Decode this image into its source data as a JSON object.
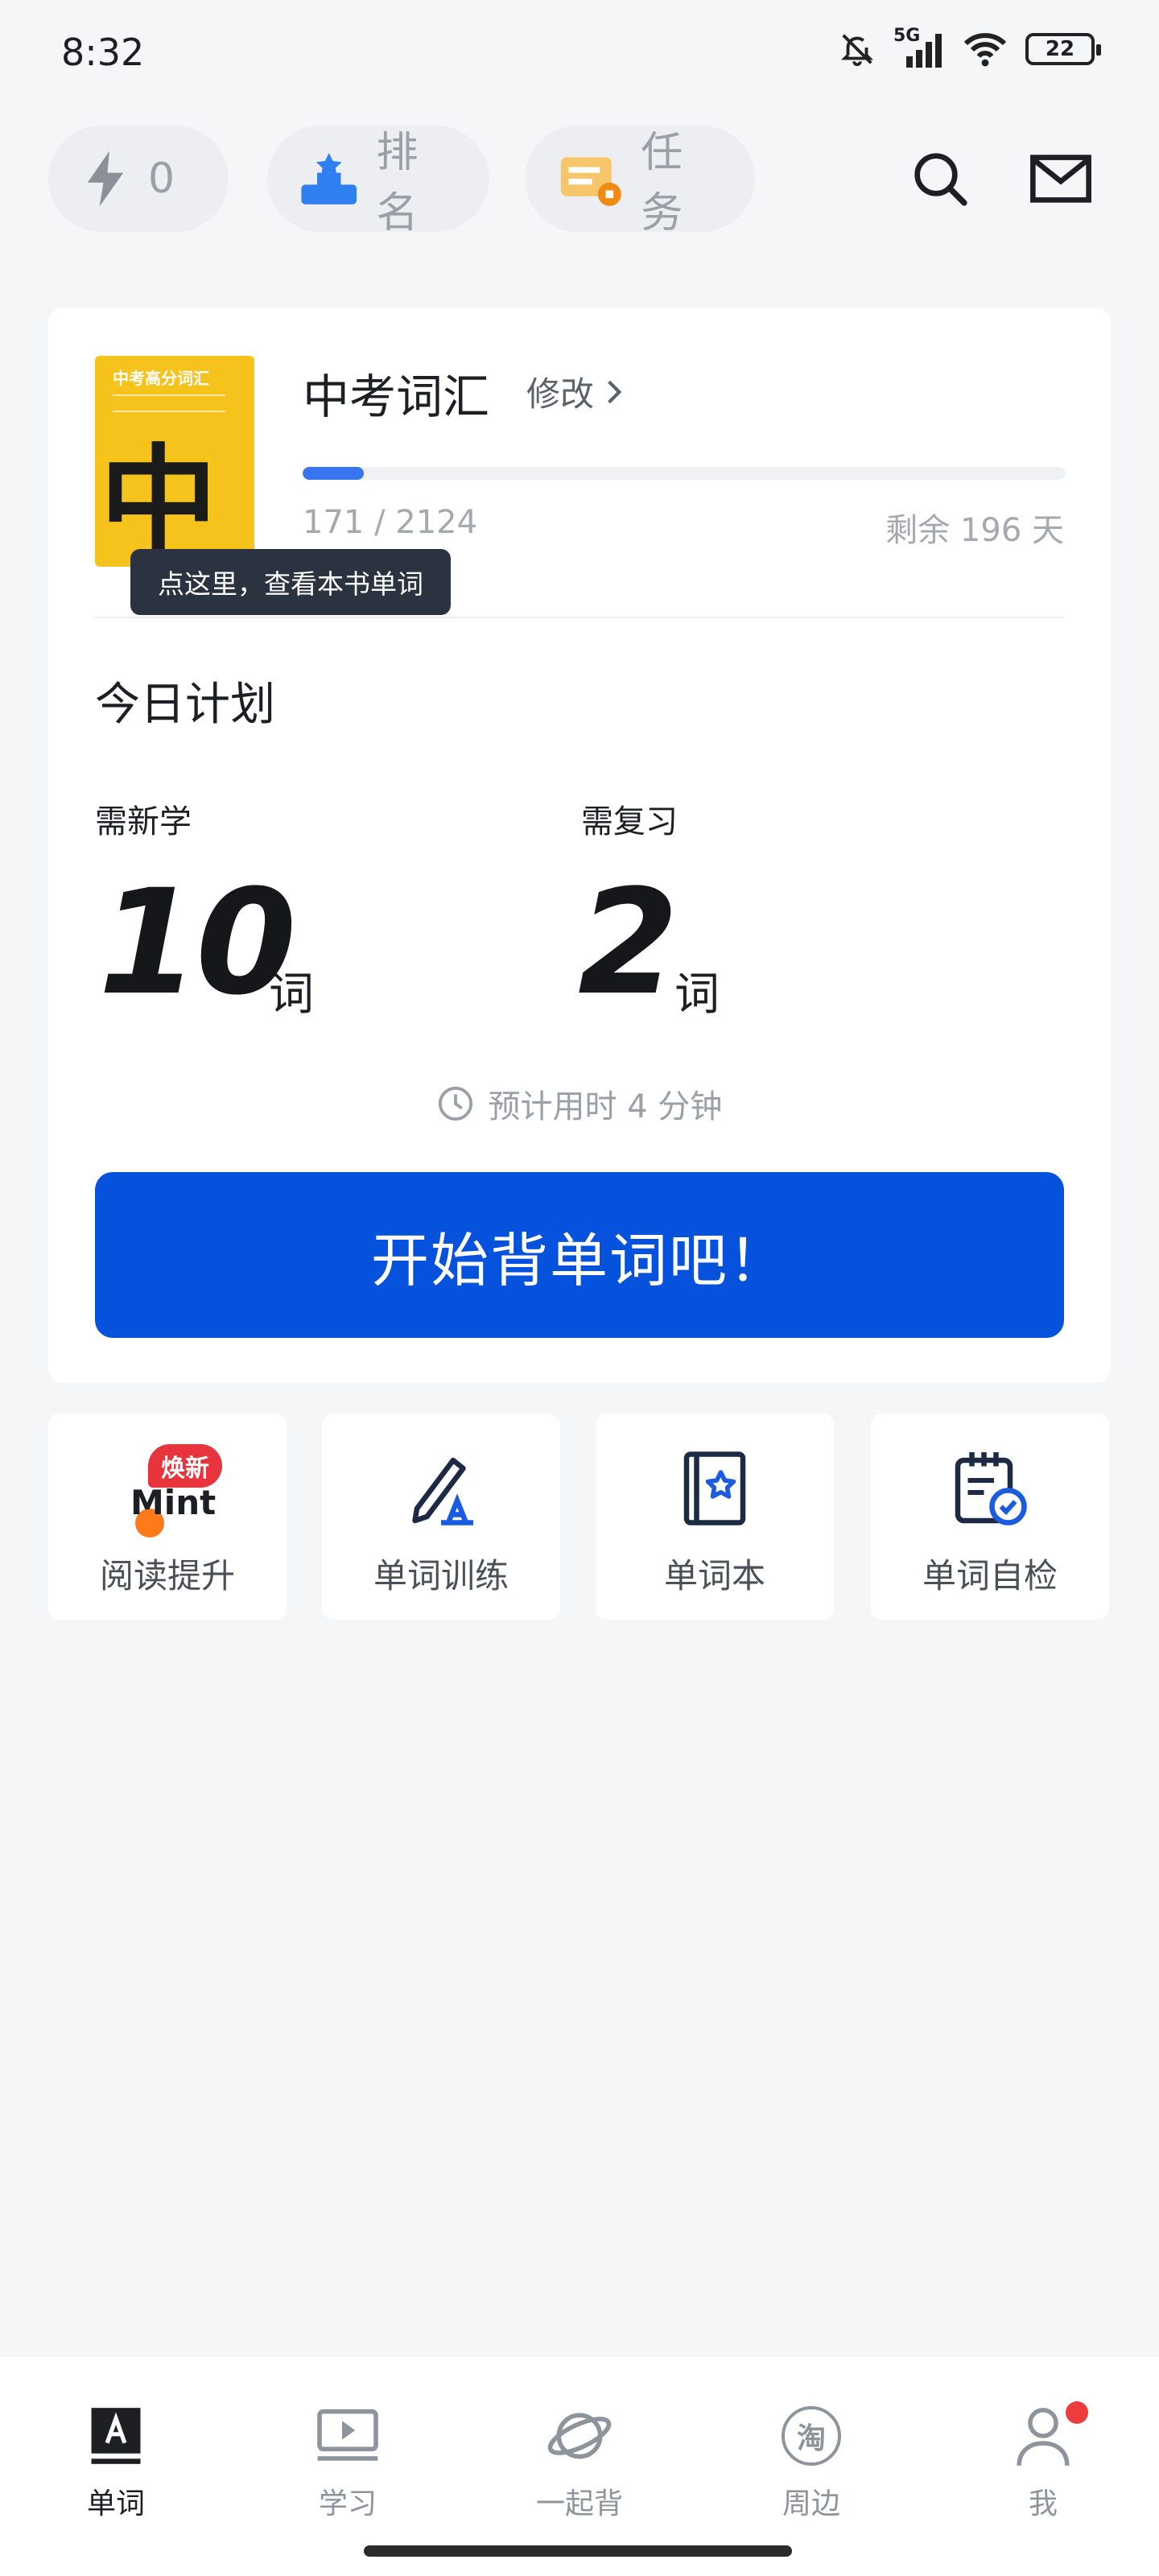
{
  "status_bar": {
    "time": "8:32",
    "network": "5G",
    "battery": "22"
  },
  "top": {
    "energy_value": "0",
    "rank_label": "排名",
    "task_label": "任务"
  },
  "book": {
    "cover_title": "中考高分词汇",
    "cover_big": "中考",
    "title": "中考词汇",
    "edit_label": "修改",
    "learned": 171,
    "total": 2124,
    "progress_text": "171 / 2124",
    "progress_fraction": 0.08,
    "remaining_text": "剩余 196 天",
    "tooltip": "点这里，查看本书单词"
  },
  "plan": {
    "title": "今日计划",
    "new_label": "需新学",
    "new_count": "10",
    "review_label": "需复习",
    "review_count": "2",
    "unit": "词",
    "estimate": "预计用时 4 分钟",
    "start_button": "开始背单词吧！"
  },
  "tiles": [
    {
      "label": "阅读提升",
      "badge": "焕新",
      "logo_text": "Mint"
    },
    {
      "label": "单词训练"
    },
    {
      "label": "单词本"
    },
    {
      "label": "单词自检"
    }
  ],
  "nav": [
    {
      "label": "单词",
      "icon": "word-icon",
      "active": true
    },
    {
      "label": "学习",
      "icon": "video-icon"
    },
    {
      "label": "一起背",
      "icon": "planet-icon"
    },
    {
      "label": "周边",
      "icon": "taobao-icon",
      "icon_text": "淘"
    },
    {
      "label": "我",
      "icon": "person-icon"
    }
  ],
  "colors": {
    "accent": "#0652dd",
    "progress": "#3a75f0",
    "badge": "#e8343c"
  }
}
